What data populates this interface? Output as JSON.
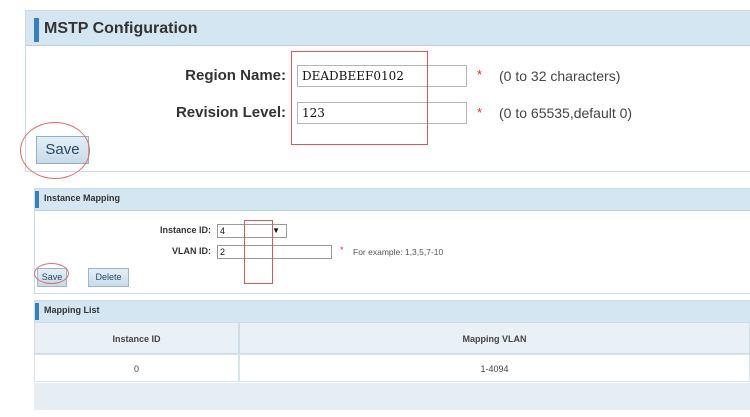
{
  "mstp": {
    "title": "MSTP Configuration",
    "region_name_label": "Region Name:",
    "region_name_value": "DEADBEEF0102",
    "region_name_hint": "(0 to 32 characters)",
    "revision_level_label": "Revision Level:",
    "revision_level_value": "123",
    "revision_level_hint": "(0 to 65535,default 0)",
    "required_mark": "*",
    "save_label": "Save"
  },
  "instance_mapping": {
    "title": "Instance Mapping",
    "instance_id_label": "Instance ID:",
    "instance_id_value": "4",
    "vlan_id_label": "VLAN ID:",
    "vlan_id_value": "2",
    "vlan_hint": "For example: 1,3,5,7-10",
    "required_mark": "*",
    "save_label": "Save",
    "delete_label": "Delete",
    "dropdown_icon": "caret-down-icon"
  },
  "mapping_list": {
    "title": "Mapping List",
    "columns": [
      "Instance ID",
      "Mapping VLAN"
    ],
    "rows": [
      {
        "instance_id": "0",
        "mapping_vlan": "1-4094"
      }
    ]
  },
  "colors": {
    "header_bg": "#d4e6f1",
    "accent_bar": "#3a7fba",
    "annotation_red": "#e05555",
    "required_star": "#e03030"
  }
}
